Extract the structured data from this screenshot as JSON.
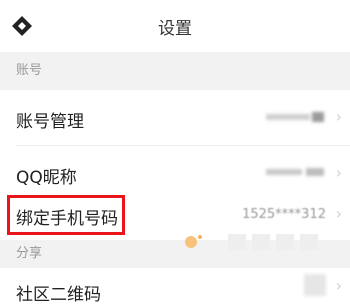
{
  "header": {
    "title": "设置",
    "back_icon": "back-diamond-icon"
  },
  "sections": {
    "account": "账号",
    "share": "分享"
  },
  "rows": {
    "account_manage": {
      "label": "账号管理",
      "value": ""
    },
    "qq_nickname": {
      "label": "QQ昵称",
      "value": ""
    },
    "bind_phone": {
      "label": "绑定手机号码",
      "value": "1525****312"
    },
    "community_qr": {
      "label": "社区二维码"
    }
  },
  "colors": {
    "highlight": "#e8151b",
    "section_bg": "#f2f2f2"
  }
}
